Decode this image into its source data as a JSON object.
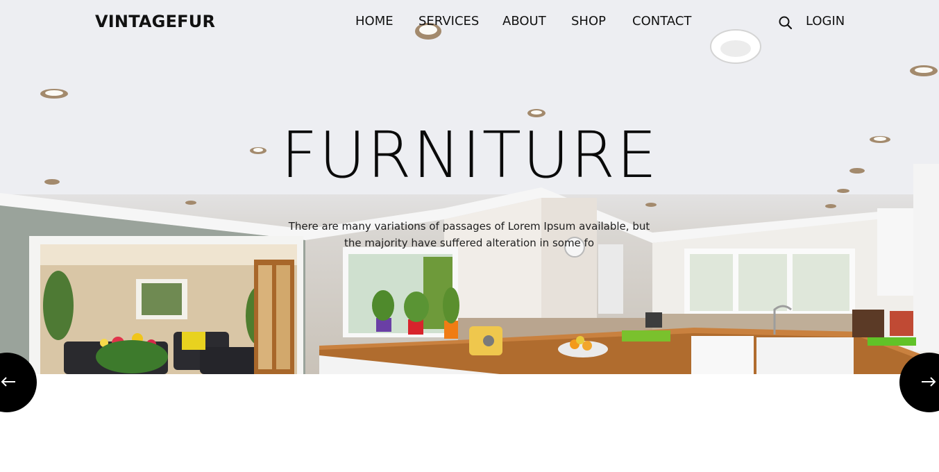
{
  "header": {
    "logo": "VINTAGEFUR",
    "nav": [
      "HOME",
      "SERVICES",
      "ABOUT",
      "SHOP",
      "CONTACT"
    ],
    "search_icon": "search-icon",
    "login_label": "LOGIN"
  },
  "hero": {
    "title": "FURNITURE",
    "subtitle_line1": "There are many variations of passages of Lorem Ipsum available, but",
    "subtitle_line2": "the majority have suffered alteration in some fo",
    "background": "kitchen-interior-photo"
  },
  "slider": {
    "prev_icon": "arrow-left-icon",
    "next_icon": "arrow-right-icon"
  },
  "colors": {
    "text": "#111111",
    "arrow_bg": "#000000",
    "page_bg": "#ffffff"
  }
}
